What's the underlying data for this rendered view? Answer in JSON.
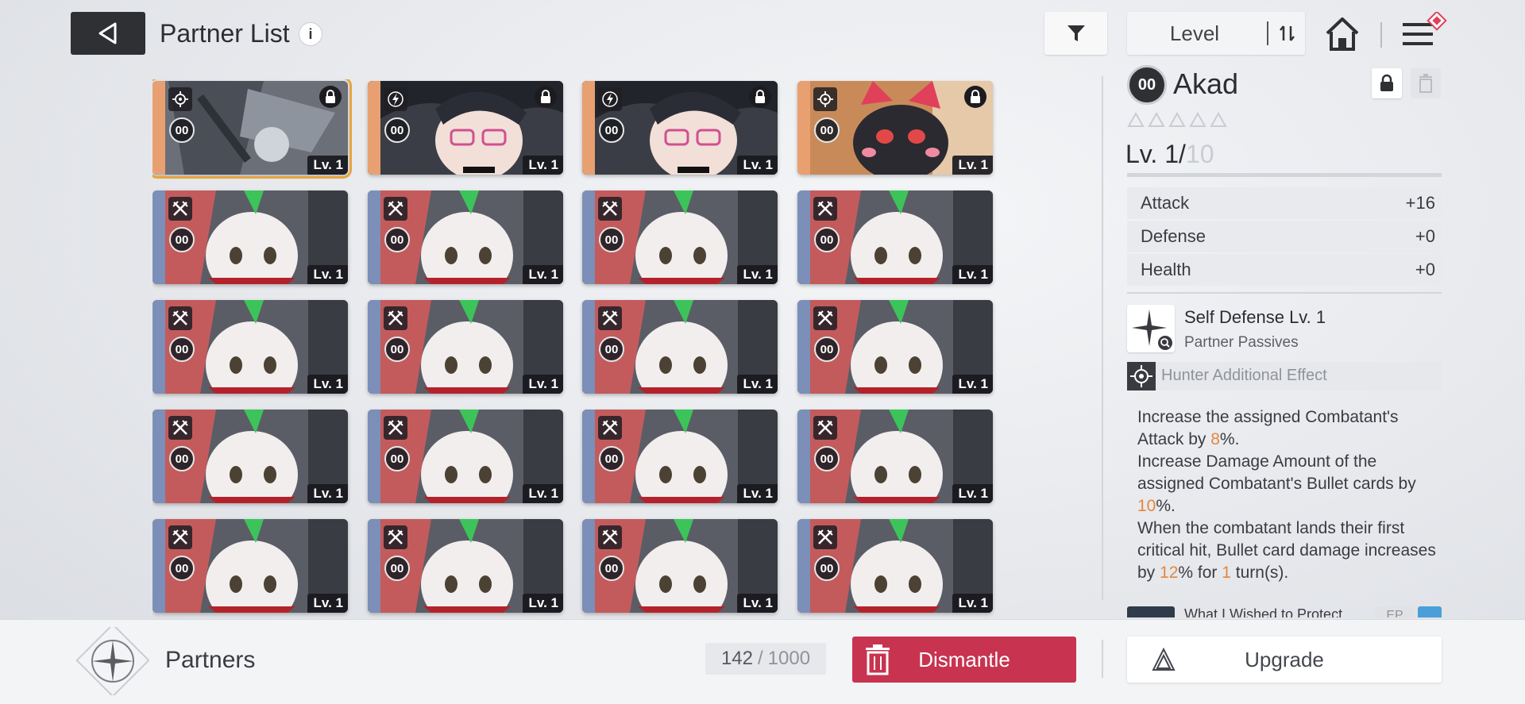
{
  "header": {
    "title": "Partner List",
    "info_glyph": "i",
    "sort_label": "Level"
  },
  "colors": {
    "accent_orange": "#e7a43e",
    "dismantle_red": "#c8334f",
    "highlight_orange": "#e5873b"
  },
  "partners": [
    {
      "grade": "00",
      "level": "Lv. 1",
      "type": "hunter-icon",
      "locked": true,
      "selected": true,
      "art": "mech"
    },
    {
      "grade": "00",
      "level": "Lv. 1",
      "type": "lightning-icon",
      "locked": true,
      "selected": false,
      "art": "glasses"
    },
    {
      "grade": "00",
      "level": "Lv. 1",
      "type": "lightning-icon",
      "locked": true,
      "selected": false,
      "art": "glasses"
    },
    {
      "grade": "00",
      "level": "Lv. 1",
      "type": "hunter-icon",
      "locked": true,
      "selected": false,
      "art": "cat"
    },
    {
      "grade": "00",
      "level": "Lv. 1",
      "type": "crossed-blades-icon",
      "locked": false,
      "selected": false,
      "art": "bunny"
    },
    {
      "grade": "00",
      "level": "Lv. 1",
      "type": "crossed-blades-icon",
      "locked": false,
      "selected": false,
      "art": "bunny"
    },
    {
      "grade": "00",
      "level": "Lv. 1",
      "type": "crossed-blades-icon",
      "locked": false,
      "selected": false,
      "art": "bunny"
    },
    {
      "grade": "00",
      "level": "Lv. 1",
      "type": "crossed-blades-icon",
      "locked": false,
      "selected": false,
      "art": "bunny"
    },
    {
      "grade": "00",
      "level": "Lv. 1",
      "type": "crossed-blades-icon",
      "locked": false,
      "selected": false,
      "art": "bunny"
    },
    {
      "grade": "00",
      "level": "Lv. 1",
      "type": "crossed-blades-icon",
      "locked": false,
      "selected": false,
      "art": "bunny"
    },
    {
      "grade": "00",
      "level": "Lv. 1",
      "type": "crossed-blades-icon",
      "locked": false,
      "selected": false,
      "art": "bunny"
    },
    {
      "grade": "00",
      "level": "Lv. 1",
      "type": "crossed-blades-icon",
      "locked": false,
      "selected": false,
      "art": "bunny"
    },
    {
      "grade": "00",
      "level": "Lv. 1",
      "type": "crossed-blades-icon",
      "locked": false,
      "selected": false,
      "art": "bunny"
    },
    {
      "grade": "00",
      "level": "Lv. 1",
      "type": "crossed-blades-icon",
      "locked": false,
      "selected": false,
      "art": "bunny"
    },
    {
      "grade": "00",
      "level": "Lv. 1",
      "type": "crossed-blades-icon",
      "locked": false,
      "selected": false,
      "art": "bunny"
    },
    {
      "grade": "00",
      "level": "Lv. 1",
      "type": "crossed-blades-icon",
      "locked": false,
      "selected": false,
      "art": "bunny"
    },
    {
      "grade": "00",
      "level": "Lv. 1",
      "type": "crossed-blades-icon",
      "locked": false,
      "selected": false,
      "art": "bunny"
    },
    {
      "grade": "00",
      "level": "Lv. 1",
      "type": "crossed-blades-icon",
      "locked": false,
      "selected": false,
      "art": "bunny"
    },
    {
      "grade": "00",
      "level": "Lv. 1",
      "type": "crossed-blades-icon",
      "locked": false,
      "selected": false,
      "art": "bunny"
    },
    {
      "grade": "00",
      "level": "Lv. 1",
      "type": "crossed-blades-icon",
      "locked": false,
      "selected": false,
      "art": "bunny"
    }
  ],
  "detail": {
    "grade": "00",
    "name": "Akad",
    "stars_filled": 0,
    "stars_total": 5,
    "level_current": "Lv. 1/",
    "level_max": "10",
    "level_progress": 0,
    "stats": [
      {
        "label": "Attack",
        "value": "+16"
      },
      {
        "label": "Defense",
        "value": "+0"
      },
      {
        "label": "Health",
        "value": "+0"
      }
    ],
    "skill_name": "Self Defense Lv. 1",
    "skill_type": "Partner Passives",
    "effect_label": "Hunter Additional Effect",
    "desc": {
      "p1a": "Increase the assigned Combatant's Attack by ",
      "p1v": "8",
      "p1b": "%.",
      "p2a": "Increase Damage Amount of the assigned Combatant's Bullet cards by ",
      "p2v": "10",
      "p2b": "%.",
      "p3a": "When the combatant lands their first critical hit, Bullet card damage increases by ",
      "p3v": "12",
      "p3b": "% for ",
      "p3n": "1",
      "p3c": " turn(s)."
    },
    "next_item_text": "What I Wished to Protect",
    "next_item_badge": "EP"
  },
  "footer": {
    "category": "Partners",
    "count": "142",
    "count_sep": "/",
    "count_max": "1000",
    "dismantle_label": "Dismantle",
    "upgrade_label": "Upgrade"
  }
}
